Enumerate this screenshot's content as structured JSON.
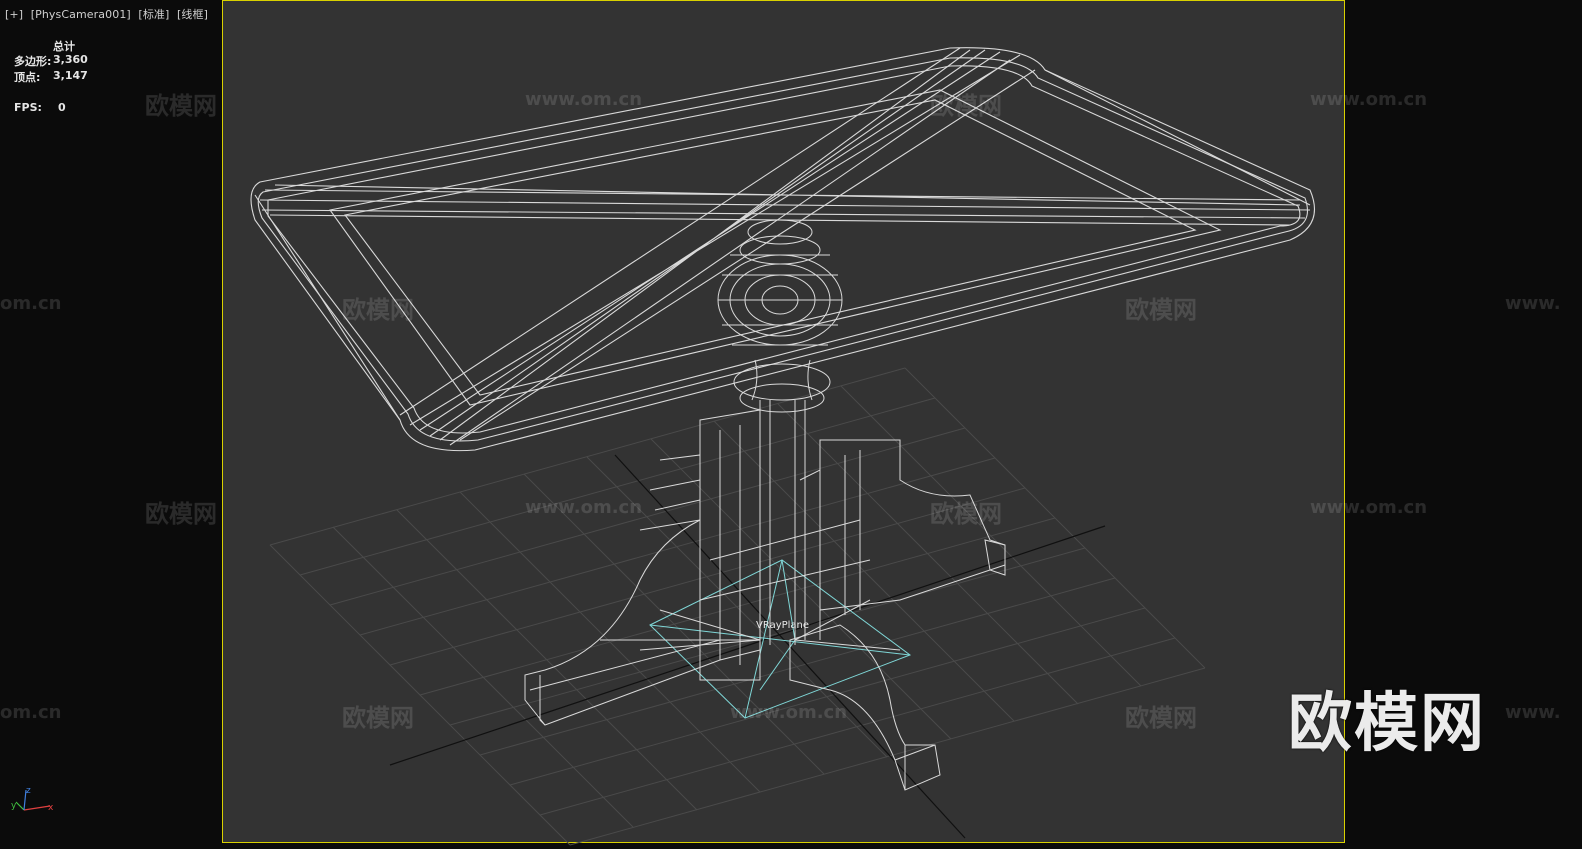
{
  "viewport": {
    "menu_label": "[+]",
    "camera_label": "[PhysCamera001]",
    "shading_label": "[标准]",
    "display_label": "[线框]"
  },
  "stats": {
    "header": "总计",
    "polygons_label": "多边形:",
    "polygons_value": "3,360",
    "vertices_label": "顶点:",
    "vertices_value": "3,147",
    "fps_label": "FPS:",
    "fps_value": "0"
  },
  "scene": {
    "object_label": "VRayPlane",
    "frame_color": "#d9d100",
    "wireframe_color": "#e0e0e0",
    "plane_color": "#7fd6d6",
    "grid_color": "#4a4a4a"
  },
  "watermarks": {
    "brand": "欧模网",
    "url": "www.om.cn",
    "url_fragment": "om.cn",
    "url_prefix": "www."
  },
  "axis_gizmo": {
    "x": "x",
    "y": "y",
    "z": "z"
  }
}
